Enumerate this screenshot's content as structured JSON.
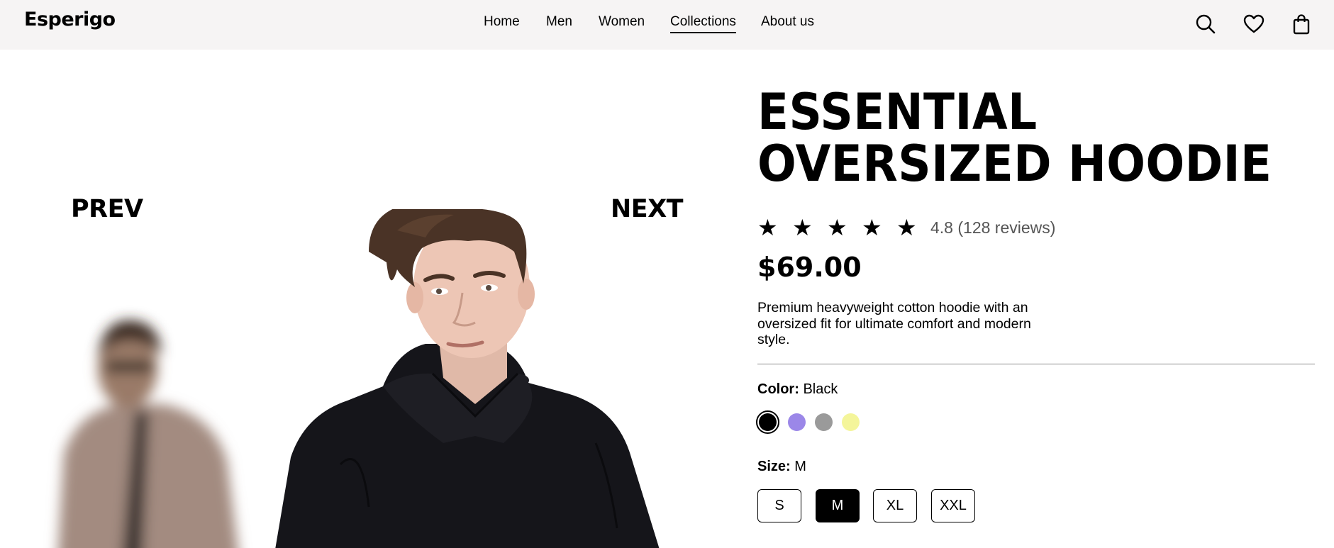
{
  "header": {
    "logo": "Esperigo",
    "nav": [
      {
        "label": "Home",
        "active": false
      },
      {
        "label": "Men",
        "active": false
      },
      {
        "label": "Women",
        "active": false
      },
      {
        "label": "Collections",
        "active": true
      },
      {
        "label": "About us",
        "active": false
      }
    ],
    "icons": [
      "search-icon",
      "heart-icon",
      "shopping-bag-icon"
    ]
  },
  "gallery": {
    "prev_label": "PREV",
    "next_label": "NEXT"
  },
  "product": {
    "title_line1": "ESSENTIAL",
    "title_line2": "OVERSIZED HOODIE",
    "rating": {
      "stars": 5,
      "text": "4.8 (128 reviews)"
    },
    "price": "$69.00",
    "description": "Premium heavyweight cotton hoodie with an oversized fit for ultimate comfort and modern style.",
    "color": {
      "label": "Color:",
      "value": "Black",
      "swatches": [
        {
          "name": "Black",
          "hex": "#000000",
          "selected": true
        },
        {
          "name": "Purple",
          "hex": "#9b87e8",
          "selected": false
        },
        {
          "name": "Gray",
          "hex": "#9a9a9a",
          "selected": false
        },
        {
          "name": "Yellow",
          "hex": "#f4f59a",
          "selected": false
        }
      ]
    },
    "size": {
      "label": "Size:",
      "value": "M",
      "options": [
        {
          "label": "S",
          "selected": false
        },
        {
          "label": "M",
          "selected": true
        },
        {
          "label": "XL",
          "selected": false
        },
        {
          "label": "XXL",
          "selected": false
        }
      ]
    }
  }
}
